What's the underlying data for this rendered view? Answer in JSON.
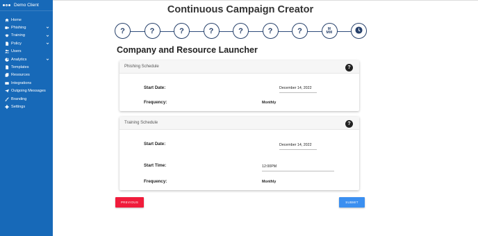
{
  "brand": {
    "name": "Demo Client"
  },
  "sidebar": {
    "items": [
      {
        "label": "Home",
        "icon": "home-icon",
        "expandable": false
      },
      {
        "label": "Phishing",
        "icon": "phishing-icon",
        "expandable": true
      },
      {
        "label": "Training",
        "icon": "graduation-cap-icon",
        "expandable": true
      },
      {
        "label": "Policy",
        "icon": "document-icon",
        "expandable": true
      },
      {
        "label": "Users",
        "icon": "users-icon",
        "expandable": false
      },
      {
        "label": "Analytics",
        "icon": "chart-icon",
        "expandable": true
      },
      {
        "label": "Templates",
        "icon": "file-icon",
        "expandable": false
      },
      {
        "label": "Resources",
        "icon": "copy-icon",
        "expandable": false
      },
      {
        "label": "Integrations",
        "icon": "plug-icon",
        "expandable": false
      },
      {
        "label": "Outgoing Messages",
        "icon": "paper-plane-icon",
        "expandable": false
      },
      {
        "label": "Branding",
        "icon": "paint-brush-icon",
        "expandable": false
      },
      {
        "label": "Settings",
        "icon": "gear-icon",
        "expandable": false
      }
    ]
  },
  "page": {
    "title": "Continuous Campaign Creator",
    "heading": "Company and Resource Launcher"
  },
  "stepper": {
    "steps": [
      {
        "label": "?"
      },
      {
        "label": "?"
      },
      {
        "label": "?"
      },
      {
        "label": "?"
      },
      {
        "label": "?"
      },
      {
        "label": "?"
      },
      {
        "label": "?"
      },
      {
        "label": "M MM",
        "top": "M",
        "bottom": "MM"
      },
      {
        "label": "clock",
        "icon": "clock-icon"
      }
    ]
  },
  "phishing": {
    "title": "Phishing Schedule",
    "start_label": "Start Date:",
    "start_value": "December 14, 2022",
    "freq_label": "Frequency:",
    "freq_value": "Monthly"
  },
  "training": {
    "title": "Training Schedule",
    "start_label": "Start Date:",
    "start_value": "December 14, 2022",
    "time_label": "Start Time:",
    "time_value": "12:00PM",
    "freq_label": "Frequency:",
    "freq_value": "Monthly"
  },
  "buttons": {
    "previous": "PREVIOUS",
    "submit": "SUBMIT"
  },
  "colors": {
    "sidebar": "#1769b8",
    "previous": "#f01c3b",
    "submit": "#3b8ff0",
    "stepper": "#27416b"
  }
}
